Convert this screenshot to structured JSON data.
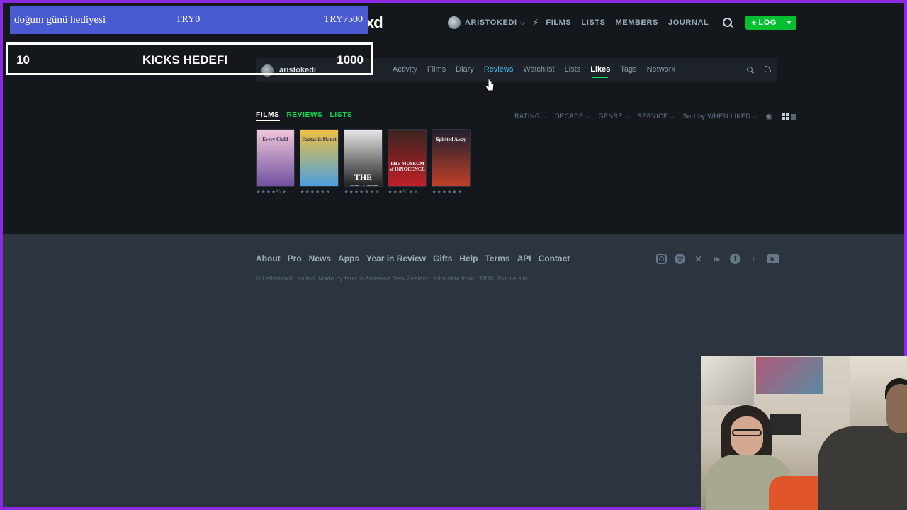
{
  "header": {
    "logo_fragment": "xd",
    "username": "ARISTOKEDI",
    "nav": [
      "FILMS",
      "LISTS",
      "MEMBERS",
      "JOURNAL"
    ],
    "log_button": "LOG",
    "icons": [
      "avatar",
      "chevron-down-icon",
      "activity-bolt-icon",
      "search-icon",
      "plus-icon"
    ]
  },
  "profile_nav": {
    "username": "aristokedi",
    "tabs": [
      {
        "label": "Activity"
      },
      {
        "label": "Films"
      },
      {
        "label": "Diary"
      },
      {
        "label": "Reviews",
        "state": "hover"
      },
      {
        "label": "Watchlist"
      },
      {
        "label": "Lists"
      },
      {
        "label": "Likes",
        "state": "active"
      },
      {
        "label": "Tags"
      },
      {
        "label": "Network"
      }
    ]
  },
  "content": {
    "tabs": [
      {
        "label": "FILMS",
        "state": "active"
      },
      {
        "label": "REVIEWS"
      },
      {
        "label": "LISTS"
      }
    ],
    "filters": [
      "RATING",
      "DECADE",
      "GENRE",
      "SERVICE",
      "Sort by WHEN LIKED"
    ],
    "films": [
      {
        "poster_text": "Every Child",
        "rating": "★★★★½",
        "liked": true,
        "has_review": false,
        "colors": [
          "#f0c8d8",
          "#7050a0"
        ]
      },
      {
        "poster_text": "Fantastic Planet",
        "rating": "★★★★★",
        "liked": true,
        "has_review": false,
        "colors": [
          "#f0c040",
          "#4aa0e0"
        ]
      },
      {
        "poster_text": "THE CRAFT",
        "rating": "★★★★★",
        "liked": true,
        "has_review": true,
        "colors": [
          "#e8e8e8",
          "#202020"
        ]
      },
      {
        "poster_text": "THE MUSEUM of INNOCENCE",
        "rating": "★★★½",
        "liked": true,
        "has_review": true,
        "colors": [
          "#3a2420",
          "#c02028"
        ]
      },
      {
        "poster_text": "Spirited Away",
        "rating": "★★★★★",
        "liked": true,
        "has_review": false,
        "colors": [
          "#202030",
          "#c04028"
        ]
      }
    ]
  },
  "footer": {
    "links": [
      "About",
      "Pro",
      "News",
      "Apps",
      "Year in Review",
      "Gifts",
      "Help",
      "Terms",
      "API",
      "Contact"
    ],
    "credit": "© Letterboxd Limited. Made by fans in Aotearoa New Zealand. Film data from TMDB. Mobile site.",
    "social_icons": [
      "instagram-icon",
      "threads-icon",
      "x-icon",
      "bluesky-icon",
      "facebook-icon",
      "tiktok-icon",
      "youtube-icon"
    ]
  },
  "overlays": {
    "donation": {
      "title": "doğum günü hediyesi",
      "current": "TRY0",
      "goal": "TRY7500",
      "color": "#4a5ad0"
    },
    "kicks": {
      "current": "10",
      "title": "KICKS HEDEFI",
      "goal": "1000"
    }
  },
  "colors": {
    "page_bg": "#14181c",
    "footer_bg": "#2c3440",
    "accent_green": "#00e054",
    "link_blue": "#40bcf4",
    "frame_border": "#8a2be2"
  }
}
